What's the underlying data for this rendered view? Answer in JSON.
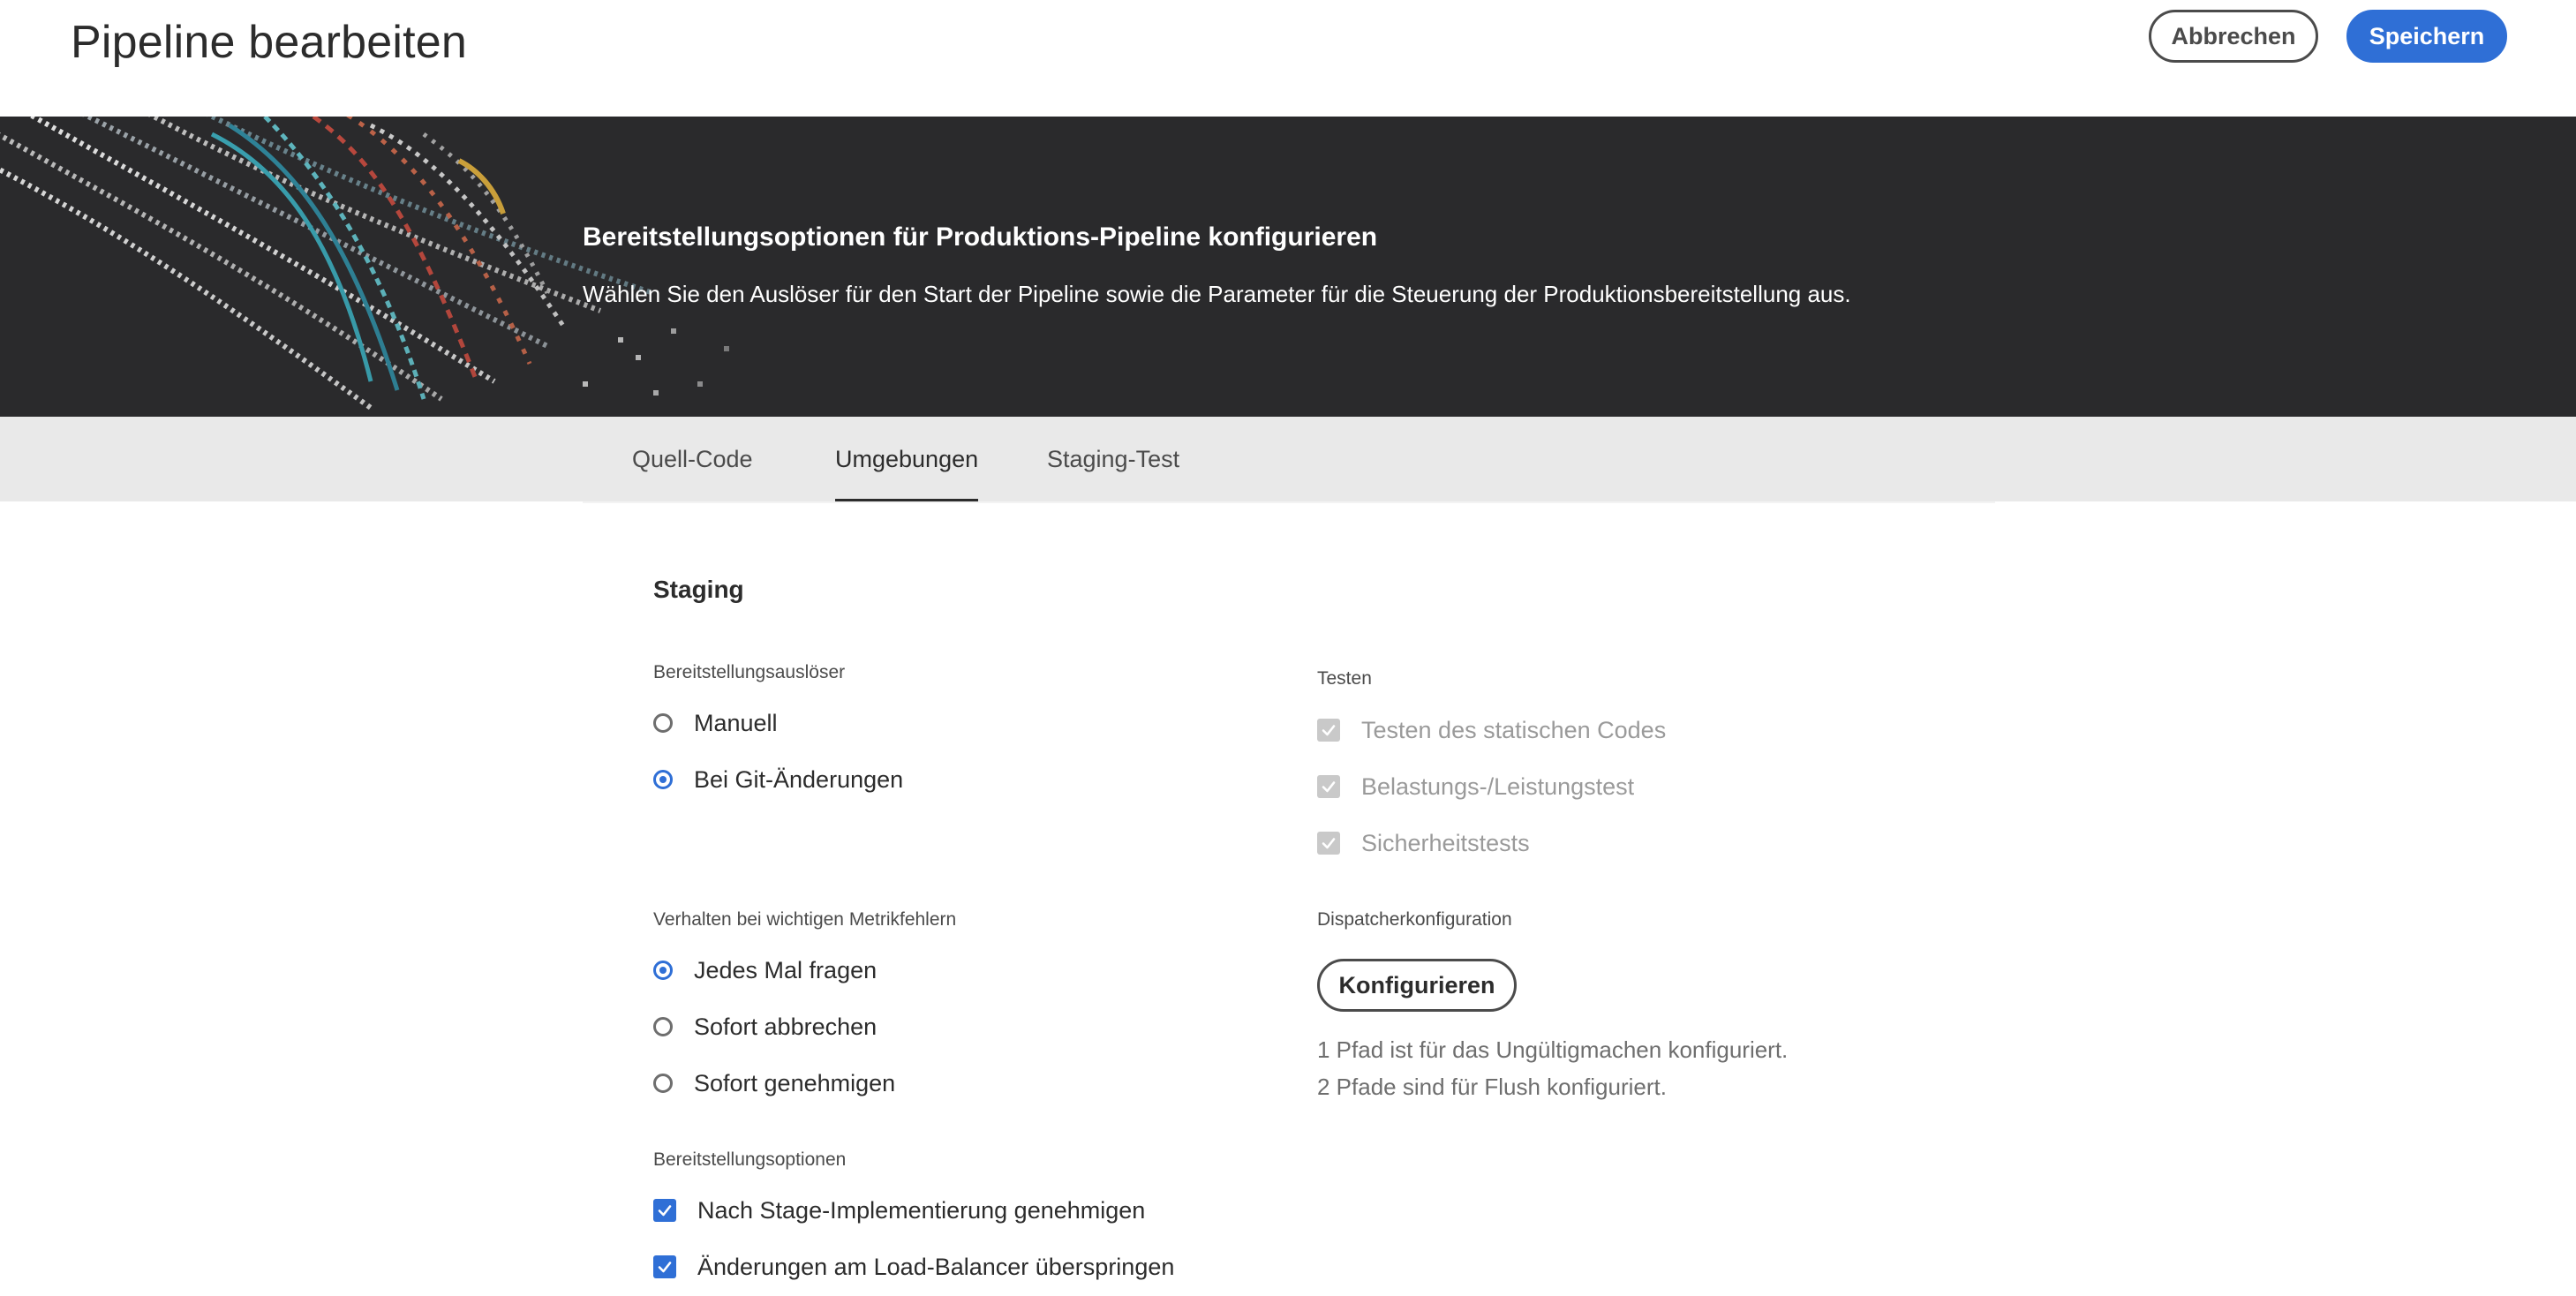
{
  "header": {
    "title": "Pipeline bearbeiten",
    "cancel_label": "Abbrechen",
    "save_label": "Speichern"
  },
  "hero": {
    "title": "Bereitstellungsoptionen für Produktions-Pipeline konfigurieren",
    "subtitle": "Wählen Sie den Auslöser für den Start der Pipeline sowie die Parameter für die Steuerung der Produktionsbereitstellung aus."
  },
  "tabs": [
    {
      "label": "Quell-Code",
      "active": false
    },
    {
      "label": "Umgebungen",
      "active": true
    },
    {
      "label": "Staging-Test",
      "active": false
    }
  ],
  "content": {
    "section_title": "Staging",
    "trigger": {
      "label": "Bereitstellungsauslöser",
      "options": [
        {
          "label": "Manuell",
          "selected": false
        },
        {
          "label": "Bei Git-Änderungen",
          "selected": true
        }
      ]
    },
    "metric": {
      "label": "Verhalten bei wichtigen Metrikfehlern",
      "options": [
        {
          "label": "Jedes Mal fragen",
          "selected": true
        },
        {
          "label": "Sofort abbrechen",
          "selected": false
        },
        {
          "label": "Sofort genehmigen",
          "selected": false
        }
      ]
    },
    "deploy_options": {
      "label": "Bereitstellungsoptionen",
      "options": [
        {
          "label": "Nach Stage-Implementierung genehmigen",
          "checked": true
        },
        {
          "label": "Änderungen am Load-Balancer überspringen",
          "checked": true
        }
      ]
    },
    "testing": {
      "label": "Testen",
      "options": [
        {
          "label": "Testen des statischen Codes",
          "checked": true,
          "disabled": true
        },
        {
          "label": "Belastungs-/Leistungstest",
          "checked": true,
          "disabled": true
        },
        {
          "label": "Sicherheitstests",
          "checked": true,
          "disabled": true
        }
      ]
    },
    "dispatcher": {
      "label": "Dispatcherkonfiguration",
      "button_label": "Konfigurieren",
      "info_line1": "1 Pfad ist für das Ungültigmachen konfiguriert.",
      "info_line2": "2 Pfade sind für Flush konfiguriert."
    }
  },
  "colors": {
    "accent": "#2f6fd6",
    "hero_bg": "#2a2a2c",
    "tabbar_bg": "#e9e9e9",
    "disabled": "#9a9a9a"
  }
}
